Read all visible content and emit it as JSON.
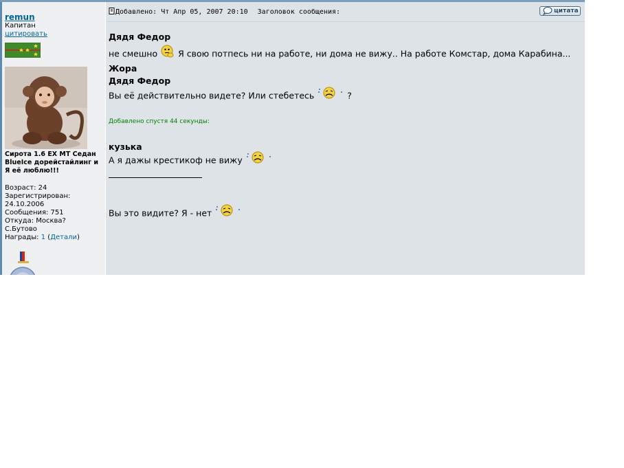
{
  "sidebar": {
    "username": "remun",
    "rank": "Капитан",
    "quote_link": "цитировать",
    "car_line1": "Сирота 1.6 EX MT Седан",
    "car_line2": "BlueIce дорейстайлинг и",
    "car_line3": "Я её люблю!!!",
    "age": "Возраст: 24",
    "registered_label": "Зарегистрирован:",
    "registered_date": "24.10.2006",
    "messages": "Сообщения: 751",
    "from_label": "Откуда: Москва?",
    "from_area": "С.Бутово",
    "awards_label": "Награды:",
    "awards_count": "1",
    "awards_details": "Детали"
  },
  "post": {
    "added": "Добавлено: Чт Апр 05, 2007 20:10",
    "subject_label": "Заголовок сообщения:",
    "quote_button": "цитата",
    "lines": {
      "l1": "Дядя Федор",
      "l2a": "не смешно",
      "l2b": "Я свою потпесь ни на работе, ни дома не вижу.. На работе Комстар, дома Карабина...",
      "l3": "Жора",
      "l4": "Дядя Федор",
      "l5a": "Вы её действительно видете? Или стебетесь",
      "l5b": "?",
      "added_after": "Добавлено спустя 44 секунды:",
      "l6": "кузька",
      "l7": "А я дажы крестикоф не вижу",
      "l8": "Вы это видите? Я - нет"
    }
  },
  "colors": {
    "post_bg": "#dee3e7",
    "sidebar_bg": "#eff0f2",
    "link": "#006699",
    "added_green": "#008000"
  },
  "icons": [
    "post-icon",
    "quote-icon",
    "thinking-smiley-icon",
    "sad-smiley-icon",
    "rank-stars-icon",
    "medal-icon",
    "badge-icon"
  ]
}
